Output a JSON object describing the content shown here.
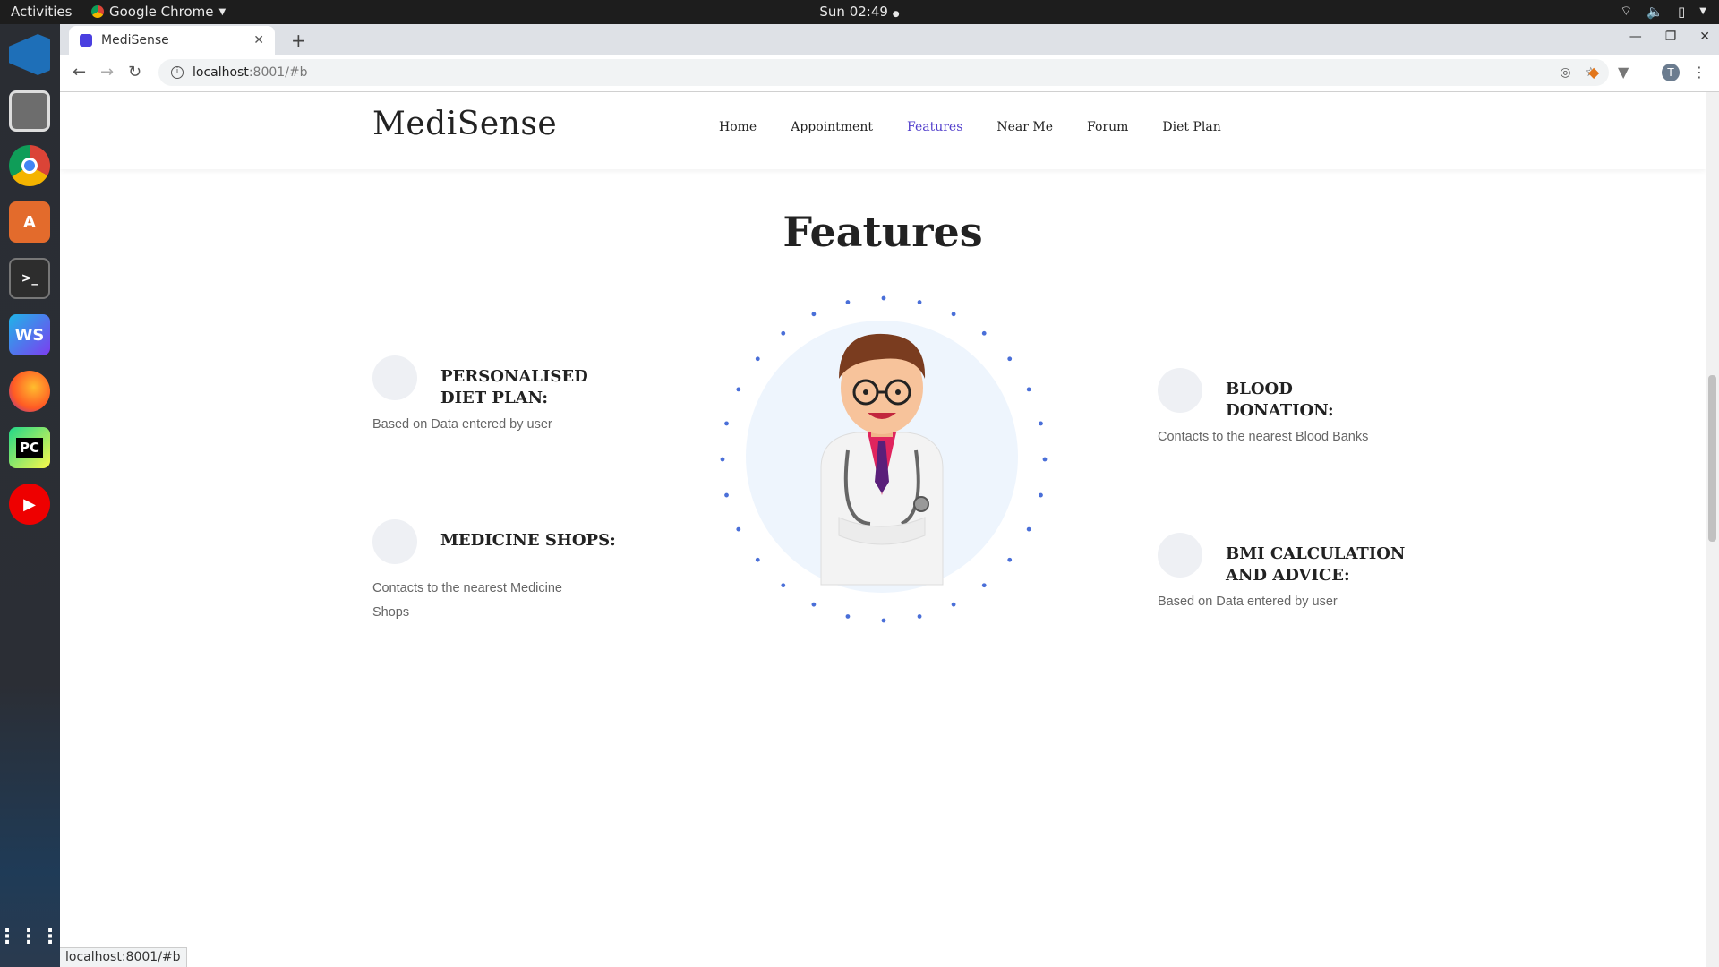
{
  "system": {
    "activities": "Activities",
    "app_name": "Google Chrome",
    "clock": "Sun 02:49"
  },
  "browser": {
    "tab_title": "MediSense",
    "url_host": "localhost",
    "url_rest": ":8001/#b",
    "status_url": "localhost:8001/#b"
  },
  "site": {
    "brand": "MediSense",
    "nav": [
      "Home",
      "Appointment",
      "Features",
      "Near Me",
      "Forum",
      "Diet Plan"
    ],
    "active_nav": "Features",
    "section_title": "Features",
    "features": [
      {
        "title": "PERSONALISED DIET PLAN:",
        "desc": "Based on Data entered by user"
      },
      {
        "title": "MEDICINE SHOPS:",
        "desc": "Contacts to the nearest Medicine Shops"
      },
      {
        "title": "BLOOD DONATION:",
        "desc": "Contacts to the nearest Blood Banks"
      },
      {
        "title": "BMI CALCULATION AND ADVICE:",
        "desc": "Based on Data entered by user"
      }
    ]
  },
  "colors": {
    "accent": "#5340cc",
    "dots": "#4a6fd8",
    "circle_bg": "#eef5fd"
  },
  "dock_icons": [
    "vscode-icon",
    "files-icon",
    "chrome-icon",
    "software-icon",
    "terminal-icon",
    "webstorm-icon",
    "firefox-icon",
    "pycharm-icon",
    "youtube-music-icon",
    "apps-grid-icon"
  ]
}
